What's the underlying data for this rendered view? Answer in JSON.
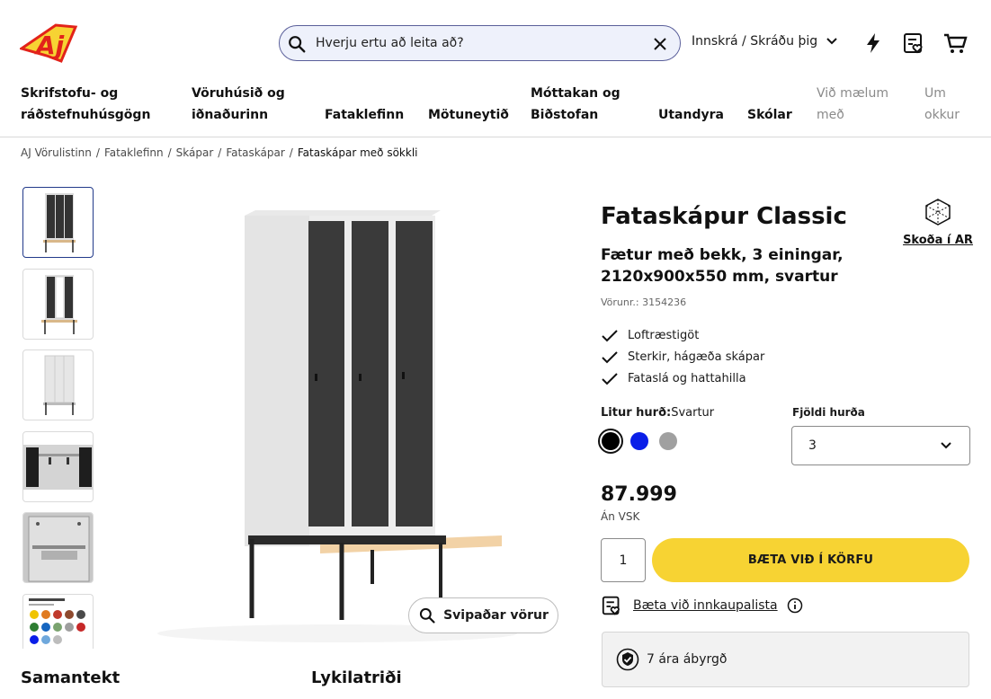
{
  "brand": {
    "logo_text": "AJ",
    "accent": "#f7d333",
    "logo_red": "#e2231a"
  },
  "search": {
    "placeholder": "Hverju ertu að leita að?"
  },
  "header": {
    "login_label": "Innskrá / Skráðu þig"
  },
  "nav": [
    {
      "label": "Skrifstofu- og ráðstefnuhúsgögn"
    },
    {
      "label": "Vöruhúsið og iðnaðurinn"
    },
    {
      "label": "Fataklefinn"
    },
    {
      "label": "Mötuneytið"
    },
    {
      "label": "Móttakan og Biðstofan"
    },
    {
      "label": "Utandyra"
    },
    {
      "label": "Skólar"
    },
    {
      "label": "Við mælum með"
    },
    {
      "label": "Um okkur"
    }
  ],
  "breadcrumb": [
    "AJ Vörulistinn",
    "Fataklefinn",
    "Skápar",
    "Fataskápar",
    "Fataskápar með sökkli"
  ],
  "product": {
    "title": "Fataskápur Classic",
    "subtitle": "Fætur með bekk, 3 einingar, 2120x900x550 mm, svartur",
    "sku": "Vörunr.: 3154236",
    "ar_label": "Skoða í AR",
    "features": [
      "Loftræstigöt",
      "Sterkir, hágæða skápar",
      "Fataslá og hattahilla"
    ],
    "color_label": "Litur hurð:",
    "color_value": "Svartur",
    "colors": [
      "#000000",
      "#0a1ee8",
      "#a0a0a0"
    ],
    "selected_color_index": 0,
    "doors_label": "Fjöldi hurða",
    "doors_value": "3",
    "price": "87.999",
    "vat_note": "Án VSK",
    "quantity": "1",
    "add_to_cart": "BÆTA VIÐ Í KÖRFU",
    "shopping_list": "Bæta við innkaupalista",
    "warranty": "7 ára ábyrgð",
    "similar": "Svipaðar vörur"
  },
  "sections": {
    "summary": "Samantekt",
    "key_features": "Lykilatriði"
  }
}
